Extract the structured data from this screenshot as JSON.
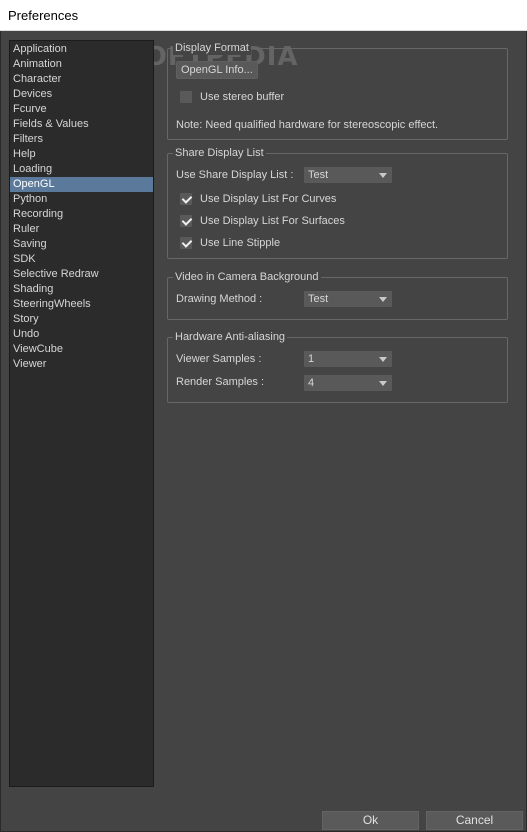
{
  "window": {
    "title": "Preferences"
  },
  "watermark": "SOFTPEDIA",
  "sidebar": {
    "items": [
      {
        "label": "Application"
      },
      {
        "label": "Animation"
      },
      {
        "label": "Character"
      },
      {
        "label": "Devices"
      },
      {
        "label": "Fcurve"
      },
      {
        "label": "Fields & Values"
      },
      {
        "label": "Filters"
      },
      {
        "label": "Help"
      },
      {
        "label": "Loading"
      },
      {
        "label": "OpenGL",
        "active": true
      },
      {
        "label": "Python"
      },
      {
        "label": "Recording"
      },
      {
        "label": "Ruler"
      },
      {
        "label": "Saving"
      },
      {
        "label": "SDK"
      },
      {
        "label": "Selective Redraw"
      },
      {
        "label": "Shading"
      },
      {
        "label": "SteeringWheels"
      },
      {
        "label": "Story"
      },
      {
        "label": "Undo"
      },
      {
        "label": "ViewCube"
      },
      {
        "label": "Viewer"
      }
    ]
  },
  "display_format": {
    "title": "Display Format",
    "info_button": "OpenGL Info...",
    "stereo_label": "Use stereo buffer",
    "stereo_checked": false,
    "note": "Note: Need qualified hardware for stereoscopic effect."
  },
  "share_display_list": {
    "title": "Share Display List",
    "use_label": "Use Share Display List :",
    "use_value": "Test",
    "curves_label": "Use Display List For Curves",
    "curves_checked": true,
    "surfaces_label": "Use Display List For Surfaces",
    "surfaces_checked": true,
    "stipple_label": "Use Line Stipple",
    "stipple_checked": true
  },
  "video_camera": {
    "title": "Video in Camera Background",
    "method_label": "Drawing Method :",
    "method_value": "Test"
  },
  "anti_aliasing": {
    "title": "Hardware Anti-aliasing",
    "viewer_label": "Viewer Samples :",
    "viewer_value": "1",
    "render_label": "Render Samples :",
    "render_value": "4"
  },
  "footer": {
    "ok_label": "Ok",
    "cancel_label": "Cancel"
  },
  "colors": {
    "background": "#444444",
    "selection": "#5b7a9b",
    "list_bg": "#2b2b2b"
  }
}
